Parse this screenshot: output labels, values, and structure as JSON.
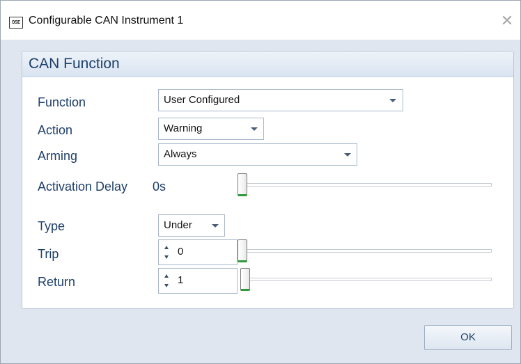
{
  "window": {
    "title": "Configurable CAN Instrument 1",
    "icon_text": "DSE",
    "close_glyph": "✕"
  },
  "panel": {
    "title": "CAN Function"
  },
  "fields": {
    "function": {
      "label": "Function",
      "value": "User Configured"
    },
    "action": {
      "label": "Action",
      "value": "Warning"
    },
    "arming": {
      "label": "Arming",
      "value": "Always"
    },
    "activation_delay": {
      "label": "Activation Delay",
      "value": "0s",
      "slider_level": 0
    },
    "type": {
      "label": "Type",
      "value": "Under"
    },
    "trip": {
      "label": "Trip",
      "value": "0",
      "slider_level": 0
    },
    "return": {
      "label": "Return",
      "value": "1",
      "slider_level": 0.01
    }
  },
  "buttons": {
    "ok": "OK"
  },
  "icons": {
    "app": "dse-app-icon",
    "close": "close-icon",
    "dropdown": "chevron-down-icon",
    "spinner": "spinner-arrows-icon"
  },
  "colors": {
    "label_text": "#1e3f69",
    "panel_header": "#d9e4f1",
    "window_bg": "#dfe6ef",
    "slider_accent": "#2e9a3a"
  }
}
